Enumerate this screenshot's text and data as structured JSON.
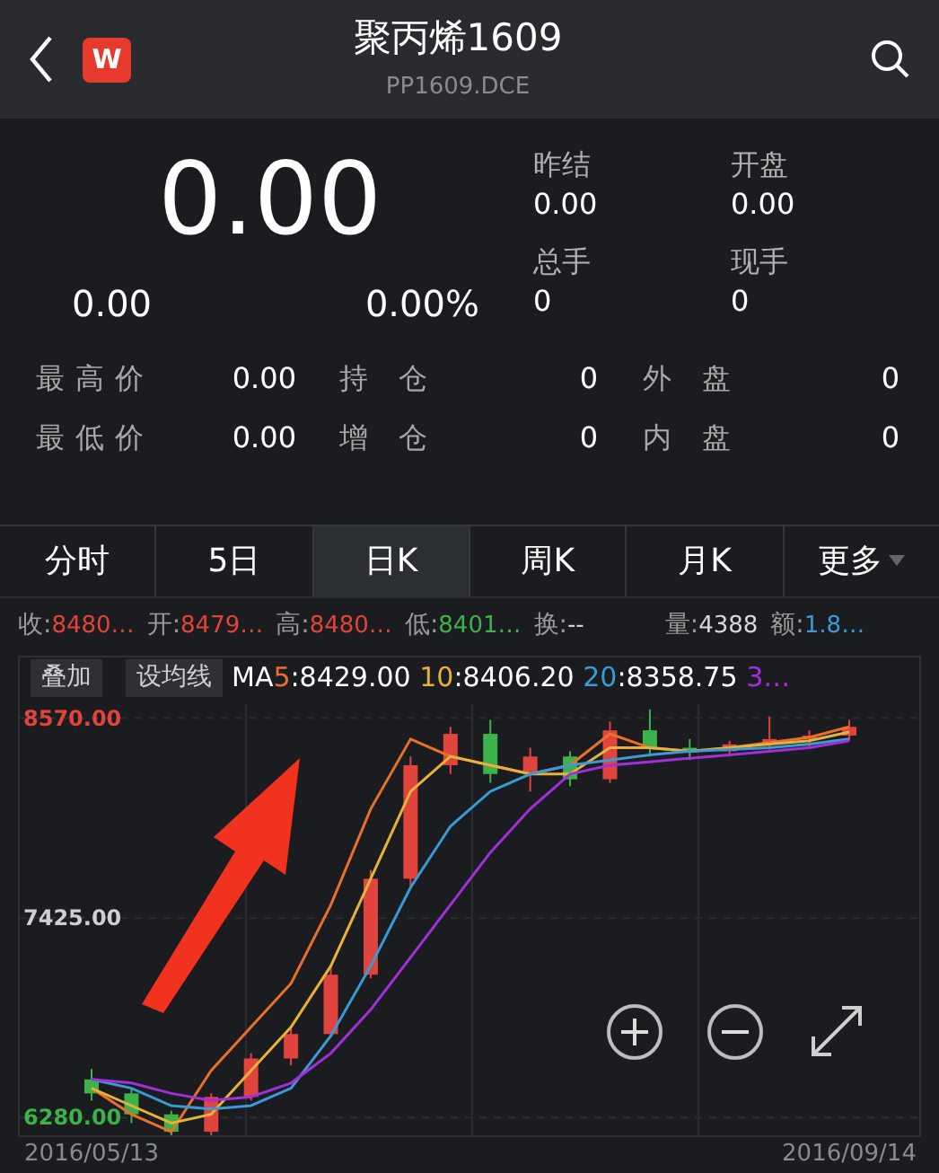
{
  "header": {
    "title": "聚丙烯1609",
    "subtitle": "PP1609.DCE",
    "logo": "W"
  },
  "quote": {
    "price": "0.00",
    "change": "0.00",
    "change_pct": "0.00%",
    "fields": [
      {
        "label": "昨结",
        "value": "0.00"
      },
      {
        "label": "开盘",
        "value": "0.00"
      },
      {
        "label": "总手",
        "value": "0"
      },
      {
        "label": "现手",
        "value": "0"
      }
    ]
  },
  "stats": [
    [
      {
        "label": "最高价",
        "value": "0.00"
      },
      {
        "label": "持 仓",
        "value": "0"
      },
      {
        "label": "外 盘",
        "value": "0"
      }
    ],
    [
      {
        "label": "最低价",
        "value": "0.00"
      },
      {
        "label": "增 仓",
        "value": "0"
      },
      {
        "label": "内 盘",
        "value": "0"
      }
    ]
  ],
  "tabs": [
    {
      "label": "分时",
      "selected": false,
      "dropdown": false
    },
    {
      "label": "5日",
      "selected": false,
      "dropdown": false
    },
    {
      "label": "日K",
      "selected": true,
      "dropdown": false
    },
    {
      "label": "周K",
      "selected": false,
      "dropdown": false
    },
    {
      "label": "月K",
      "selected": false,
      "dropdown": false
    },
    {
      "label": "更多",
      "selected": false,
      "dropdown": true
    }
  ],
  "bar_info": [
    {
      "label": "收:",
      "value": "8480…",
      "color": "#e0443c"
    },
    {
      "label": "开:",
      "value": "8479…",
      "color": "#e0443c"
    },
    {
      "label": "高:",
      "value": "8480…",
      "color": "#e0443c"
    },
    {
      "label": "低:",
      "value": "8401…",
      "color": "#3cb34a"
    },
    {
      "label": "换:",
      "value": "--",
      "color": "#d8d8d8"
    },
    {
      "label": "量:",
      "value": "4388",
      "color": "#d8d8d8"
    },
    {
      "label": "额:",
      "value": "1.8…",
      "color": "#3a9ad6"
    }
  ],
  "chart_buttons": [
    "叠加",
    "设均线"
  ],
  "ma": {
    "label": "MA",
    "values": [
      ":8429.00",
      ":8406.20",
      ":8358.75"
    ]
  },
  "chart": {
    "chart_data": {
      "type": "candlestick",
      "categories": [
        "2016/05/13",
        null,
        null,
        null,
        null,
        null,
        null,
        null,
        null,
        null,
        null,
        null,
        null,
        null,
        null,
        null,
        null,
        null,
        null,
        "2016/09/14"
      ],
      "ylim": [
        6180,
        8650
      ],
      "grid": true,
      "ohlc": [
        [
          6500,
          6560,
          6380,
          6420
        ],
        [
          6420,
          6450,
          6250,
          6300
        ],
        [
          6300,
          6320,
          6150,
          6200
        ],
        [
          6200,
          6420,
          6180,
          6400
        ],
        [
          6400,
          6650,
          6380,
          6620
        ],
        [
          6620,
          6800,
          6580,
          6760
        ],
        [
          6760,
          7150,
          6740,
          7100
        ],
        [
          7100,
          7700,
          7080,
          7650
        ],
        [
          7650,
          8350,
          7600,
          8300
        ],
        [
          8300,
          8520,
          8250,
          8480
        ],
        [
          8480,
          8560,
          8200,
          8250
        ],
        [
          8250,
          8400,
          8150,
          8350
        ],
        [
          8350,
          8380,
          8180,
          8220
        ],
        [
          8220,
          8550,
          8200,
          8500
        ],
        [
          8500,
          8620,
          8350,
          8400
        ],
        [
          8400,
          8450,
          8330,
          8380
        ],
        [
          8380,
          8440,
          8350,
          8420
        ],
        [
          8420,
          8580,
          8390,
          8450
        ],
        [
          8450,
          8500,
          8400,
          8470
        ],
        [
          8470,
          8560,
          8440,
          8520
        ]
      ],
      "yticks": [
        {
          "value": 8570,
          "label": "8570.00"
        },
        {
          "value": 7425,
          "label": "7425.00"
        },
        {
          "value": 6280,
          "label": "6280.00"
        }
      ],
      "series": [
        {
          "name": "5",
          "type": "line",
          "color": "#e8702a",
          "values": [
            6450,
            6300,
            6200,
            6550,
            6800,
            7050,
            7500,
            8050,
            8450,
            8350,
            8300,
            8250,
            8300,
            8480,
            8400,
            8380,
            8400,
            8430,
            8460,
            8520
          ]
        },
        {
          "name": "10",
          "type": "line",
          "color": "#e6b23a",
          "values": [
            6450,
            6350,
            6250,
            6300,
            6550,
            6800,
            7150,
            7650,
            8150,
            8350,
            8300,
            8250,
            8250,
            8400,
            8400,
            8380,
            8400,
            8420,
            8440,
            8490
          ]
        },
        {
          "name": "20",
          "type": "line",
          "color": "#3a9ad6",
          "values": [
            6500,
            6450,
            6350,
            6330,
            6350,
            6450,
            6750,
            7150,
            7600,
            7950,
            8150,
            8250,
            8300,
            8330,
            8360,
            8380,
            8390,
            8400,
            8420,
            8450
          ]
        },
        {
          "name": "3…",
          "type": "line",
          "color": "#a030d8",
          "values": [
            6500,
            6480,
            6420,
            6380,
            6400,
            6480,
            6650,
            6900,
            7200,
            7500,
            7800,
            8050,
            8250,
            8300,
            8320,
            8340,
            8360,
            8380,
            8400,
            8440
          ]
        }
      ]
    }
  }
}
